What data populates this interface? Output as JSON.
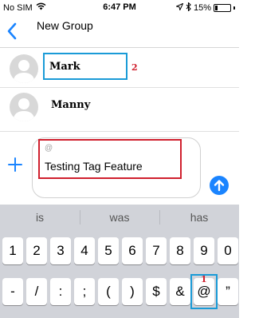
{
  "status_bar": {
    "carrier": "No SIM",
    "time": "6:47 PM",
    "battery": "15%",
    "battery_level": 0.15
  },
  "nav": {
    "title": "New Group"
  },
  "contacts": [
    {
      "name": "Mark"
    },
    {
      "name": "Manny"
    }
  ],
  "annotations": {
    "contact_callout": "2",
    "key_callout": "1"
  },
  "compose": {
    "mention_hint": "@",
    "message_text": "Testing Tag  Feature"
  },
  "keyboard": {
    "suggestions": [
      "is",
      "was",
      "has"
    ],
    "number_row": [
      "1",
      "2",
      "3",
      "4",
      "5",
      "6",
      "7",
      "8",
      "9",
      "0"
    ],
    "symbol_row": [
      "-",
      "/",
      ":",
      ";",
      "(",
      ")",
      "$",
      "&",
      "@",
      "”"
    ]
  },
  "colors": {
    "accent": "#1a84ff",
    "highlight_blue": "#1a9bd7",
    "highlight_red": "#d0202e"
  }
}
